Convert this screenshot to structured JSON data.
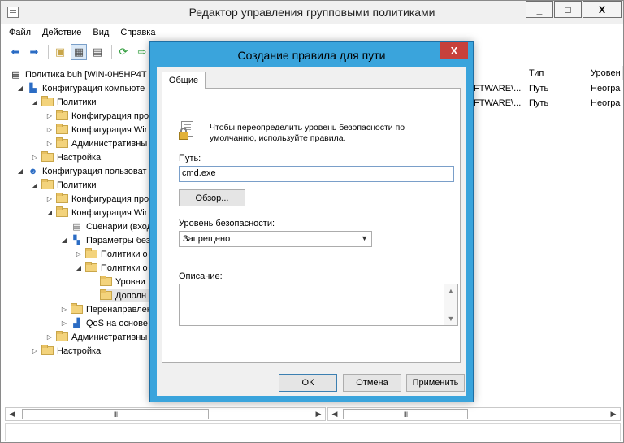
{
  "window": {
    "title": "Редактор управления групповыми политиками",
    "min": "_",
    "max": "□",
    "close": "X"
  },
  "menu": [
    "Файл",
    "Действие",
    "Вид",
    "Справка"
  ],
  "tree": [
    {
      "label": "Политика buh [WIN-0H5HP4T",
      "icon": "policy-icon",
      "exp": ""
    },
    {
      "label": "Конфигурация компьюте",
      "icon": "computer-icon",
      "exp": "◢"
    },
    {
      "label": "Политики",
      "icon": "folder",
      "exp": "◢"
    },
    {
      "label": "Конфигурация про",
      "icon": "folder",
      "exp": "▷"
    },
    {
      "label": "Конфигурация Wir",
      "icon": "folder",
      "exp": "▷"
    },
    {
      "label": "Административны",
      "icon": "folder",
      "exp": "▷"
    },
    {
      "label": "Настройка",
      "icon": "folder",
      "exp": "▷"
    },
    {
      "label": "Конфигурация пользоват",
      "icon": "user-icon",
      "exp": "◢"
    },
    {
      "label": "Политики",
      "icon": "folder",
      "exp": "◢"
    },
    {
      "label": "Конфигурация про",
      "icon": "folder",
      "exp": "▷"
    },
    {
      "label": "Конфигурация Wir",
      "icon": "folder",
      "exp": "◢"
    },
    {
      "label": "Сценарии (вход",
      "icon": "script-icon",
      "exp": ""
    },
    {
      "label": "Параметры безо",
      "icon": "security-icon",
      "exp": "◢"
    },
    {
      "label": "Политики о",
      "icon": "folder",
      "exp": "▷"
    },
    {
      "label": "Политики о",
      "icon": "folder",
      "exp": "◢"
    },
    {
      "label": "Уровни",
      "icon": "folder",
      "exp": ""
    },
    {
      "label": "Дополн",
      "icon": "folder",
      "exp": ""
    },
    {
      "label": "Перенаправлен",
      "icon": "folder",
      "exp": "▷"
    },
    {
      "label": "QoS на основе",
      "icon": "chart-icon",
      "exp": "▷"
    },
    {
      "label": "Административны",
      "icon": "folder",
      "exp": "▷"
    },
    {
      "label": "Настройка",
      "icon": "folder",
      "exp": "▷"
    }
  ],
  "list": {
    "headers": {
      "type": "Тип",
      "level": "Уровен"
    },
    "rows": [
      {
        "name": "FTWARE\\...",
        "type": "Путь",
        "level": "Неогра"
      },
      {
        "name": "FTWARE\\...",
        "type": "Путь",
        "level": "Неогра"
      }
    ]
  },
  "scroll": {
    "thumb": "III",
    "left": "◀",
    "right": "▶"
  },
  "dialog": {
    "title": "Создание правила для пути",
    "close": "X",
    "tab": "Общие",
    "description": "Чтобы переопределить уровень безопасности по умолчанию, используйте правила.",
    "path_label": "Путь:",
    "path_value": "cmd.exe",
    "browse_button": "Обзор...",
    "security_label": "Уровень безопасности:",
    "security_value": "Запрещено",
    "notes_label": "Описание:",
    "ok_button": "ОК",
    "cancel_button": "Отмена",
    "apply_button": "Применить"
  },
  "colors": {
    "dialog_frame": "#3aa4dc",
    "dialog_close": "#c7413b",
    "folder": "#f3d37c"
  }
}
